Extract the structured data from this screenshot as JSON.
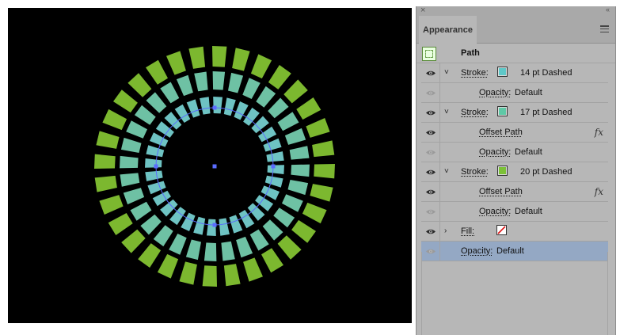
{
  "canvas": {
    "background": "#000000",
    "colors": {
      "outer": "#7cb82f",
      "middle": "#6ec1a4",
      "inner": "#6ec3c3",
      "guide": "#5a6cff"
    }
  },
  "panel": {
    "close_glyph": "×",
    "collapse_glyph": "‹‹",
    "tab_label": "Appearance",
    "menu_icon": "hamburger-icon",
    "object_label": "Path",
    "rows": [
      {
        "expand": "˅",
        "label": "Stroke:",
        "swatch": "#5fc8c8",
        "value": "14 pt Dashed",
        "eye": "visible"
      },
      {
        "label": "Opacity:",
        "value": "Default",
        "eye": "dim"
      },
      {
        "expand": "˅",
        "label": "Stroke:",
        "swatch": "#5fc8a6",
        "value": "17 pt Dashed",
        "eye": "visible"
      },
      {
        "label": "Offset Path",
        "value": "",
        "fx": "fx",
        "eye": "visible"
      },
      {
        "label": "Opacity:",
        "value": "Default",
        "eye": "dim"
      },
      {
        "expand": "˅",
        "label": "Stroke:",
        "swatch": "#7cc137",
        "value": "20 pt Dashed",
        "eye": "visible"
      },
      {
        "label": "Offset Path",
        "value": "",
        "fx": "fx",
        "eye": "visible"
      },
      {
        "label": "Opacity:",
        "value": "Default",
        "eye": "dim"
      },
      {
        "expand": "›",
        "label": "Fill:",
        "swatch": "none",
        "value": "",
        "eye": "visible"
      },
      {
        "label": "Opacity:",
        "value": "Default",
        "eye": "dim",
        "selected": true
      }
    ]
  }
}
